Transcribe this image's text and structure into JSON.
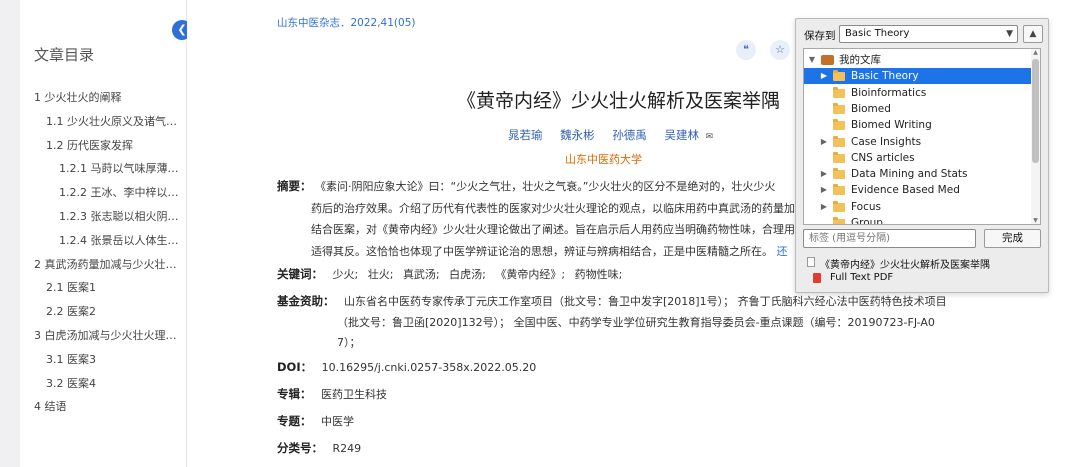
{
  "toc": {
    "title": "文章目录",
    "collapse_icon": "chevron-left-icon",
    "items": [
      {
        "label": "1 少火壮火的阐释",
        "level": 1
      },
      {
        "label": "1.1 少火壮火原义及诸气定义",
        "level": 2
      },
      {
        "label": "1.2 历代医家发挥",
        "level": 2
      },
      {
        "label": "1.2.1 马莳以气味厚薄类…",
        "level": 3
      },
      {
        "label": "1.2.2 王冰、李中梓以人…",
        "level": 3
      },
      {
        "label": "1.2.3 张志聪以相火阴火…",
        "level": 3
      },
      {
        "label": "1.2.4 张景岳以人体生理…",
        "level": 3
      },
      {
        "label": "2 真武汤药量加减与少火壮火…",
        "level": 1
      },
      {
        "label": "2.1 医案1",
        "level": 2
      },
      {
        "label": "2.2 医案2",
        "level": 2
      },
      {
        "label": "3 白虎汤加减与少火壮火理论…",
        "level": 1
      },
      {
        "label": "3.1 医案3",
        "level": 2
      },
      {
        "label": "3.2 医案4",
        "level": 2
      },
      {
        "label": "4 结语",
        "level": 1
      }
    ]
  },
  "article": {
    "journal": "山东中医杂志．2022,41(05)",
    "cite_icon": "quote-icon",
    "fav_icon": "star-icon",
    "title": "《黄帝内经》少火壮火解析及医案举隅",
    "authors": [
      "晁若瑜",
      "魏永彬",
      "孙德禹",
      "吴建林"
    ],
    "org": "山东中医药大学",
    "abstract_label": "摘要：",
    "abstract_lines": [
      "《素问·阴阳应象大论》曰：“少火之气壮，壮火之气衰。”少火壮火的区分不是绝对的，壮火少火",
      "药后的治疗效果。介绍了历代有代表性的医家对少火壮火理论的观点，以临床用药中真武汤的药量加",
      "结合医案，对《黄帝内经》少火壮火理论做出了阐述。旨在启示后人用药应当明确药物性味，合理用",
      "适得其反。这恰恰也体现了中医学辨证论治的思想，辨证与辨病相结合，正是中医精髓之所在。"
    ],
    "abstract_more": "还",
    "keywords_label": "关键词：",
    "keywords": [
      "少火;",
      "壮火;",
      "真武汤;",
      "白虎汤;",
      "《黄帝内经》;",
      "药物性味;"
    ],
    "fund_label": "基金资助：",
    "fund_lines": [
      "山东省名中医药专家传承丁元庆工作室项目（批文号：鲁卫中发字[2018]1号）；  齐鲁丁氏脑科六经心法中医药特色技术项目",
      "（批文号：鲁卫函[2020]132号）；  全国中医、中药学专业学位研究生教育指导委员会-重点课题（编号：20190723-FJ-A0",
      "7）；"
    ],
    "doi_label": "DOI：",
    "doi": "10.16295/j.cnki.0257-358x.2022.05.20",
    "series_label": "专辑：",
    "series": "医药卫生科技",
    "topic_label": "专题：",
    "topic": "中医学",
    "class_label": "分类号：",
    "class": "R249"
  },
  "popup": {
    "save_to_label": "保存到",
    "selected_collection": "Basic Theory",
    "tree": [
      {
        "label": "我的文库",
        "twisty": "▼",
        "depth": 0,
        "selected": false,
        "type": "library"
      },
      {
        "label": "Basic Theory",
        "twisty": "▶",
        "depth": 1,
        "selected": true,
        "type": "folder"
      },
      {
        "label": "Bioinformatics",
        "twisty": "",
        "depth": 1,
        "selected": false,
        "type": "folder"
      },
      {
        "label": "Biomed",
        "twisty": "",
        "depth": 1,
        "selected": false,
        "type": "folder"
      },
      {
        "label": "Biomed Writing",
        "twisty": "",
        "depth": 1,
        "selected": false,
        "type": "folder"
      },
      {
        "label": "Case Insights",
        "twisty": "▶",
        "depth": 1,
        "selected": false,
        "type": "folder"
      },
      {
        "label": "CNS articles",
        "twisty": "",
        "depth": 1,
        "selected": false,
        "type": "folder"
      },
      {
        "label": "Data Mining and Stats",
        "twisty": "▶",
        "depth": 1,
        "selected": false,
        "type": "folder"
      },
      {
        "label": "Evidence Based Med",
        "twisty": "▶",
        "depth": 1,
        "selected": false,
        "type": "folder"
      },
      {
        "label": "Focus",
        "twisty": "▶",
        "depth": 1,
        "selected": false,
        "type": "folder"
      },
      {
        "label": "Group",
        "twisty": "",
        "depth": 1,
        "selected": false,
        "type": "folder"
      }
    ],
    "tags_placeholder": "标签 (用逗号分隔)",
    "done_label": "完成",
    "item_title": "《黄帝内经》少火壮火解析及医案举隅",
    "attachment": "Full Text PDF"
  },
  "colors": {
    "link_blue": "#2f6fd8",
    "org_orange": "#e06a00",
    "selection_blue": "#1d74e8"
  }
}
